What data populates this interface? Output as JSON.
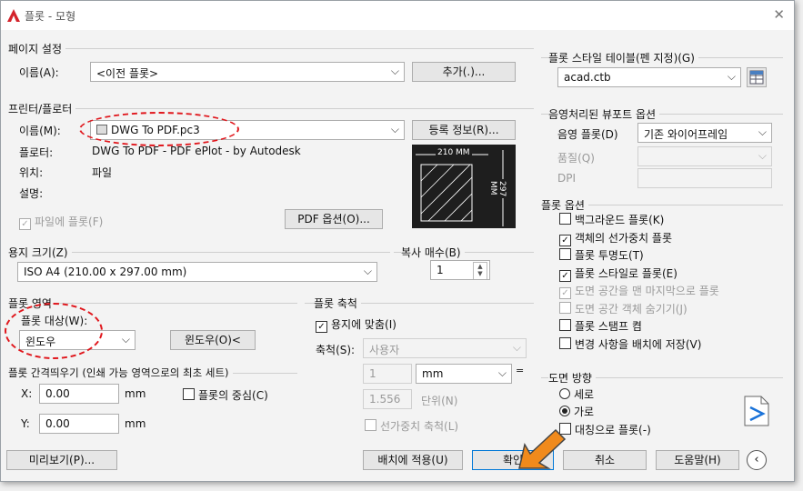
{
  "title": "플롯 - 모형",
  "page_setup": {
    "group": "페이지 설정",
    "name_label": "이름(A):",
    "name_value": "<이전 플롯>",
    "add_button": "추가(.)..."
  },
  "printer": {
    "group": "프린터/플로터",
    "name_label": "이름(M):",
    "name_value": "DWG To PDF.pc3",
    "properties_button": "등록 정보(R)...",
    "plotter_label": "플로터:",
    "plotter_value": "DWG To PDF - PDF ePlot - by Autodesk",
    "where_label": "위치:",
    "where_value": "파일",
    "desc_label": "설명:",
    "plot_to_file": "파일에 플롯(F)",
    "pdf_options_button": "PDF 옵션(O)...",
    "preview_width": "210 MM",
    "preview_height": "297 MM"
  },
  "paper_size": {
    "group": "용지 크기(Z)",
    "value": "ISO A4 (210.00 x 297.00 mm)"
  },
  "copies": {
    "label": "복사 매수(B)",
    "value": "1"
  },
  "plot_area": {
    "group": "플롯 영역",
    "what_label": "플롯 대상(W):",
    "what_value": "윈도우",
    "window_button": "윈도우(O)<"
  },
  "plot_offset": {
    "group": "플롯 간격띄우기 (인쇄 가능 영역으로의 최초 세트)",
    "x_label": "X:",
    "x_value": "0.00",
    "y_label": "Y:",
    "y_value": "0.00",
    "unit": "mm",
    "center": "플롯의 중심(C)"
  },
  "plot_scale": {
    "group": "플롯 축척",
    "fit": "용지에 맞춤(I)",
    "scale_label": "축척(S):",
    "scale_value": "사용자",
    "num": "1",
    "unit": "mm",
    "eq": "=",
    "den": "1.556",
    "den_unit": "단위(N)",
    "lineweights": "선가중치 축척(L)"
  },
  "style_table": {
    "group": "플롯 스타일 테이블(펜 지정)(G)",
    "value": "acad.ctb"
  },
  "shaded": {
    "group": "음영처리된 뷰포트 옵션",
    "shade_label": "음영 플롯(D)",
    "shade_value": "기존 와이어프레임",
    "quality_label": "품질(Q)",
    "dpi_label": "DPI"
  },
  "options": {
    "group": "플롯 옵션",
    "items": [
      {
        "label": "백그라운드 플롯(K)",
        "checked": false,
        "enabled": true
      },
      {
        "label": "객체의 선가중치 플롯",
        "checked": true,
        "enabled": true
      },
      {
        "label": "플롯 투명도(T)",
        "checked": false,
        "enabled": true
      },
      {
        "label": "플롯 스타일로 플롯(E)",
        "checked": true,
        "enabled": true
      },
      {
        "label": "도면 공간을 맨 마지막으로 플롯",
        "checked": true,
        "enabled": false
      },
      {
        "label": "도면 공간 객체 숨기기(J)",
        "checked": false,
        "enabled": false
      },
      {
        "label": "플롯 스탬프 켬",
        "checked": false,
        "enabled": true
      },
      {
        "label": "변경 사항을 배치에 저장(V)",
        "checked": false,
        "enabled": true
      }
    ]
  },
  "orientation": {
    "group": "도면 방향",
    "portrait": "세로",
    "landscape": "가로",
    "upside_down": "대칭으로 플롯(-)"
  },
  "footer": {
    "preview": "미리보기(P)...",
    "apply": "배치에 적용(U)",
    "ok": "확인",
    "cancel": "취소",
    "help": "도움말(H)"
  },
  "colors": {
    "annotation": "#e0161c",
    "arrow": "#f08a1c",
    "app_icon": "#d4232b"
  }
}
